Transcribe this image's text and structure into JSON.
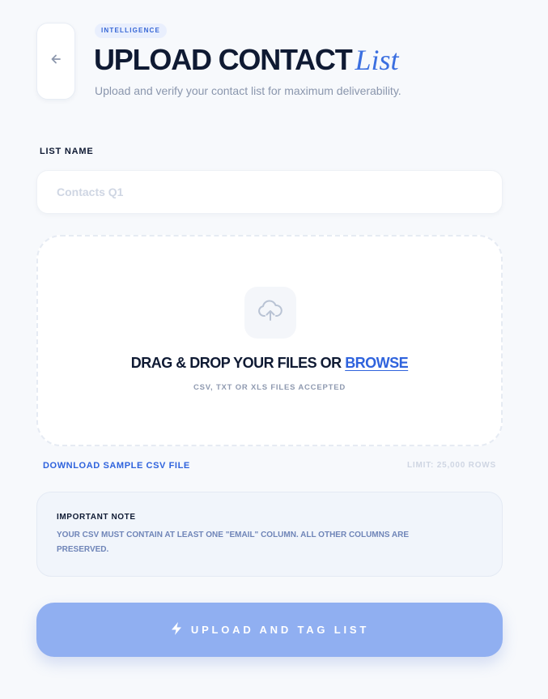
{
  "header": {
    "back_icon": "arrow-left-icon",
    "badge": "INTELLIGENCE",
    "title_main": "UPLOAD CONTACT",
    "title_accent": "List",
    "subtitle": "Upload and verify your contact list for maximum deliverability."
  },
  "form": {
    "list_name_label": "LIST NAME",
    "list_name_placeholder": "Contacts Q1",
    "list_name_value": ""
  },
  "dropzone": {
    "icon": "cloud-upload-icon",
    "title_prefix": "DRAG & DROP YOUR FILES OR",
    "browse_label": "BROWSE",
    "hint": "CSV, TXT OR XLS FILES ACCEPTED"
  },
  "links": {
    "download_sample": "DOWNLOAD SAMPLE CSV FILE",
    "limit": "LIMIT: 25,000 ROWS"
  },
  "note": {
    "title": "IMPORTANT NOTE",
    "text": "YOUR CSV MUST CONTAIN AT LEAST ONE \"EMAIL\" COLUMN. ALL OTHER COLUMNS ARE PRESERVED."
  },
  "submit": {
    "icon": "lightning-bolt-icon",
    "label": "UPLOAD AND TAG LIST"
  },
  "colors": {
    "accent": "#2f63dd",
    "background": "#f7f9fc",
    "button": "#90aff1",
    "text_dark": "#0f1a33"
  }
}
